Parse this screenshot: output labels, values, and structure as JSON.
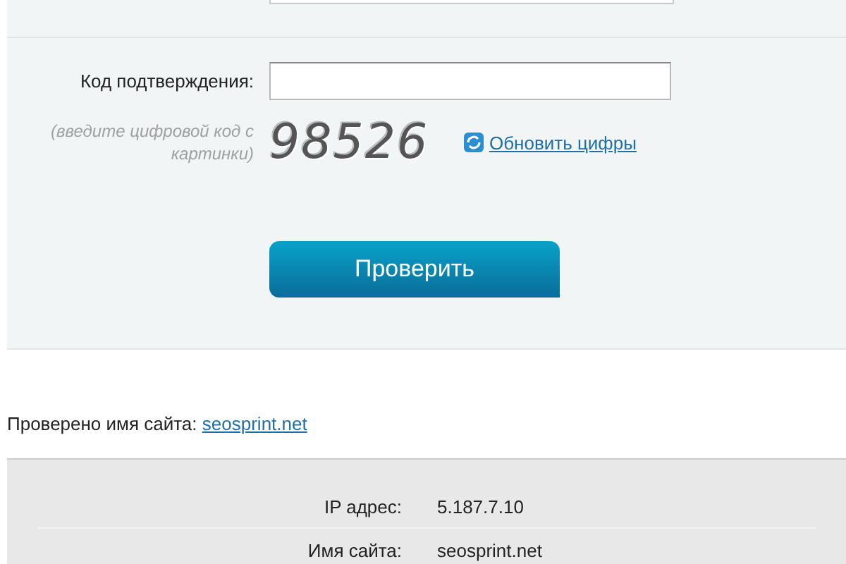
{
  "form": {
    "confirm_label": "Код подтверждения:",
    "hint": "(введите цифровой код с картинки)",
    "captcha": "98526",
    "refresh_link": "Обновить цифры",
    "submit": "Проверить"
  },
  "checked": {
    "label": "Проверено имя сайта:",
    "link": "seosprint.net"
  },
  "info_rows": [
    {
      "label": "IP адрес:",
      "value": "5.187.7.10"
    },
    {
      "label": "Имя сайта:",
      "value": "seosprint.net"
    }
  ]
}
